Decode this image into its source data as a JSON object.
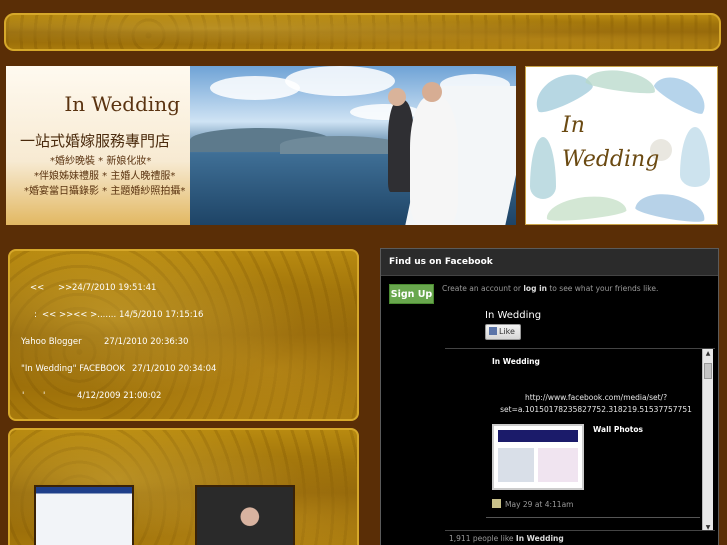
{
  "hero": {
    "title": "In Wedding",
    "subtitle": "一站式婚嫁服務專門店",
    "lines": [
      "*婚紗晚裝 * 新娘化妝*",
      "*伴娘姊妹禮服 * 主婚人晚禮服*",
      "*婚宴當日攝錄影 * 主題婚紗照拍攝*"
    ]
  },
  "logo": {
    "word1": "In",
    "word2": "Wedding"
  },
  "news": {
    "rows": [
      {
        "prefix": "<<",
        "middle": ">>",
        "date": "24/7/2010 19:51:41"
      },
      {
        "prefix": ":",
        "middle": "<<   >><<   >.......",
        "date": "14/5/2010 17:15:16"
      },
      {
        "prefix": "Yahoo Blogger",
        "middle": "",
        "date": "27/1/2010 20:36:30"
      },
      {
        "prefix": "\"In Wedding\" FACEBOOK",
        "middle": "",
        "date": "27/1/2010 20:34:04"
      },
      {
        "prefix": "'",
        "middle": "'",
        "date": "4/12/2009 21:00:02"
      }
    ]
  },
  "facebook": {
    "header": "Find us on Facebook",
    "signup": "Sign Up",
    "promo_pre": "Create an account or ",
    "promo_login": "log in",
    "promo_post": " to see what your friends like.",
    "page_name": "In Wedding",
    "like": "Like",
    "post": {
      "author": "In Wedding",
      "link": "http://www.facebook.com/media/set/?set=a.10150178235827752.318219.51537757751",
      "album": "Wall Photos",
      "meta": "May 29 at 4:11am"
    },
    "count_pre": "1,911 people like ",
    "count_page": "In Wedding"
  }
}
